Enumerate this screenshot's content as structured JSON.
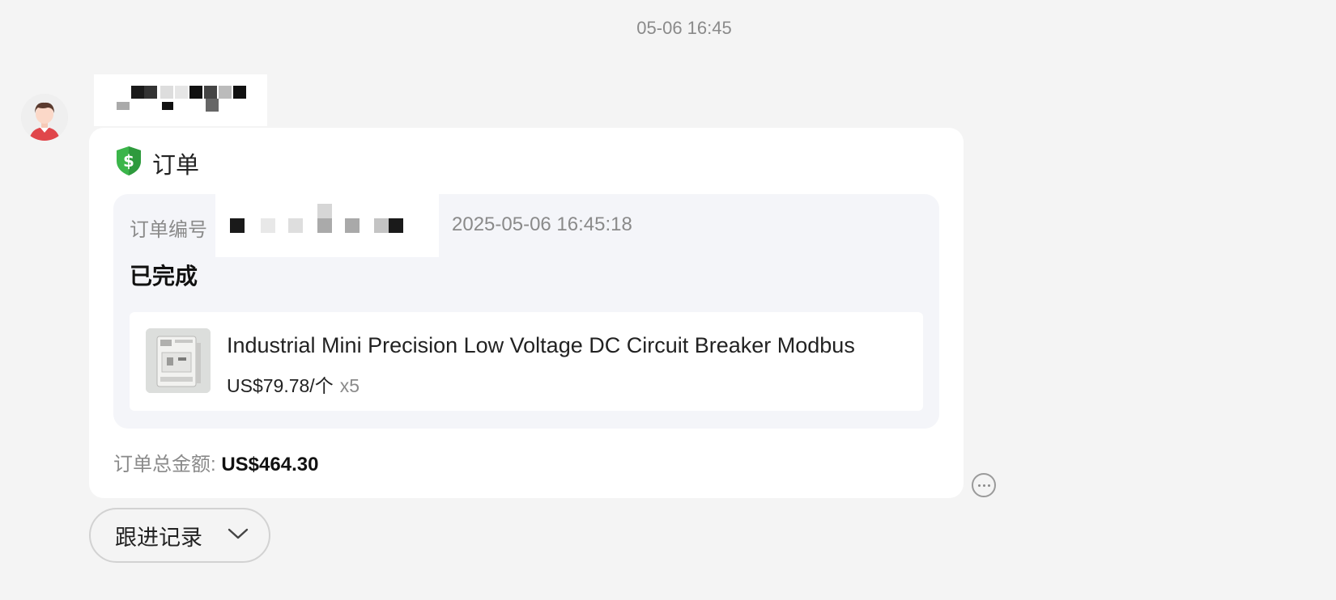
{
  "chat": {
    "timestamp": "05-06 16:45",
    "sender": {
      "avatar_icon": "user-avatar-icon"
    }
  },
  "order_card": {
    "icon": "dollar-shield-icon",
    "title": "订单",
    "order_number_label": "订单编号",
    "order_time": "2025-05-06 16:45:18",
    "status": "已完成",
    "product": {
      "title": "Industrial Mini Precision Low Voltage DC Circuit Breaker Modbus",
      "price": "US$79.78/个",
      "quantity": "x5"
    },
    "total_label": "订单总金额:",
    "total_value": "US$464.30"
  },
  "actions": {
    "more_icon": "more-options-icon",
    "followup_label": "跟进记录",
    "followup_icon": "chevron-down-icon"
  },
  "colors": {
    "background": "#f4f4f4",
    "card": "#ffffff",
    "inner_panel": "#f4f5f9",
    "muted_text": "#8a8a8a",
    "shield_green": "#3bb54a"
  }
}
